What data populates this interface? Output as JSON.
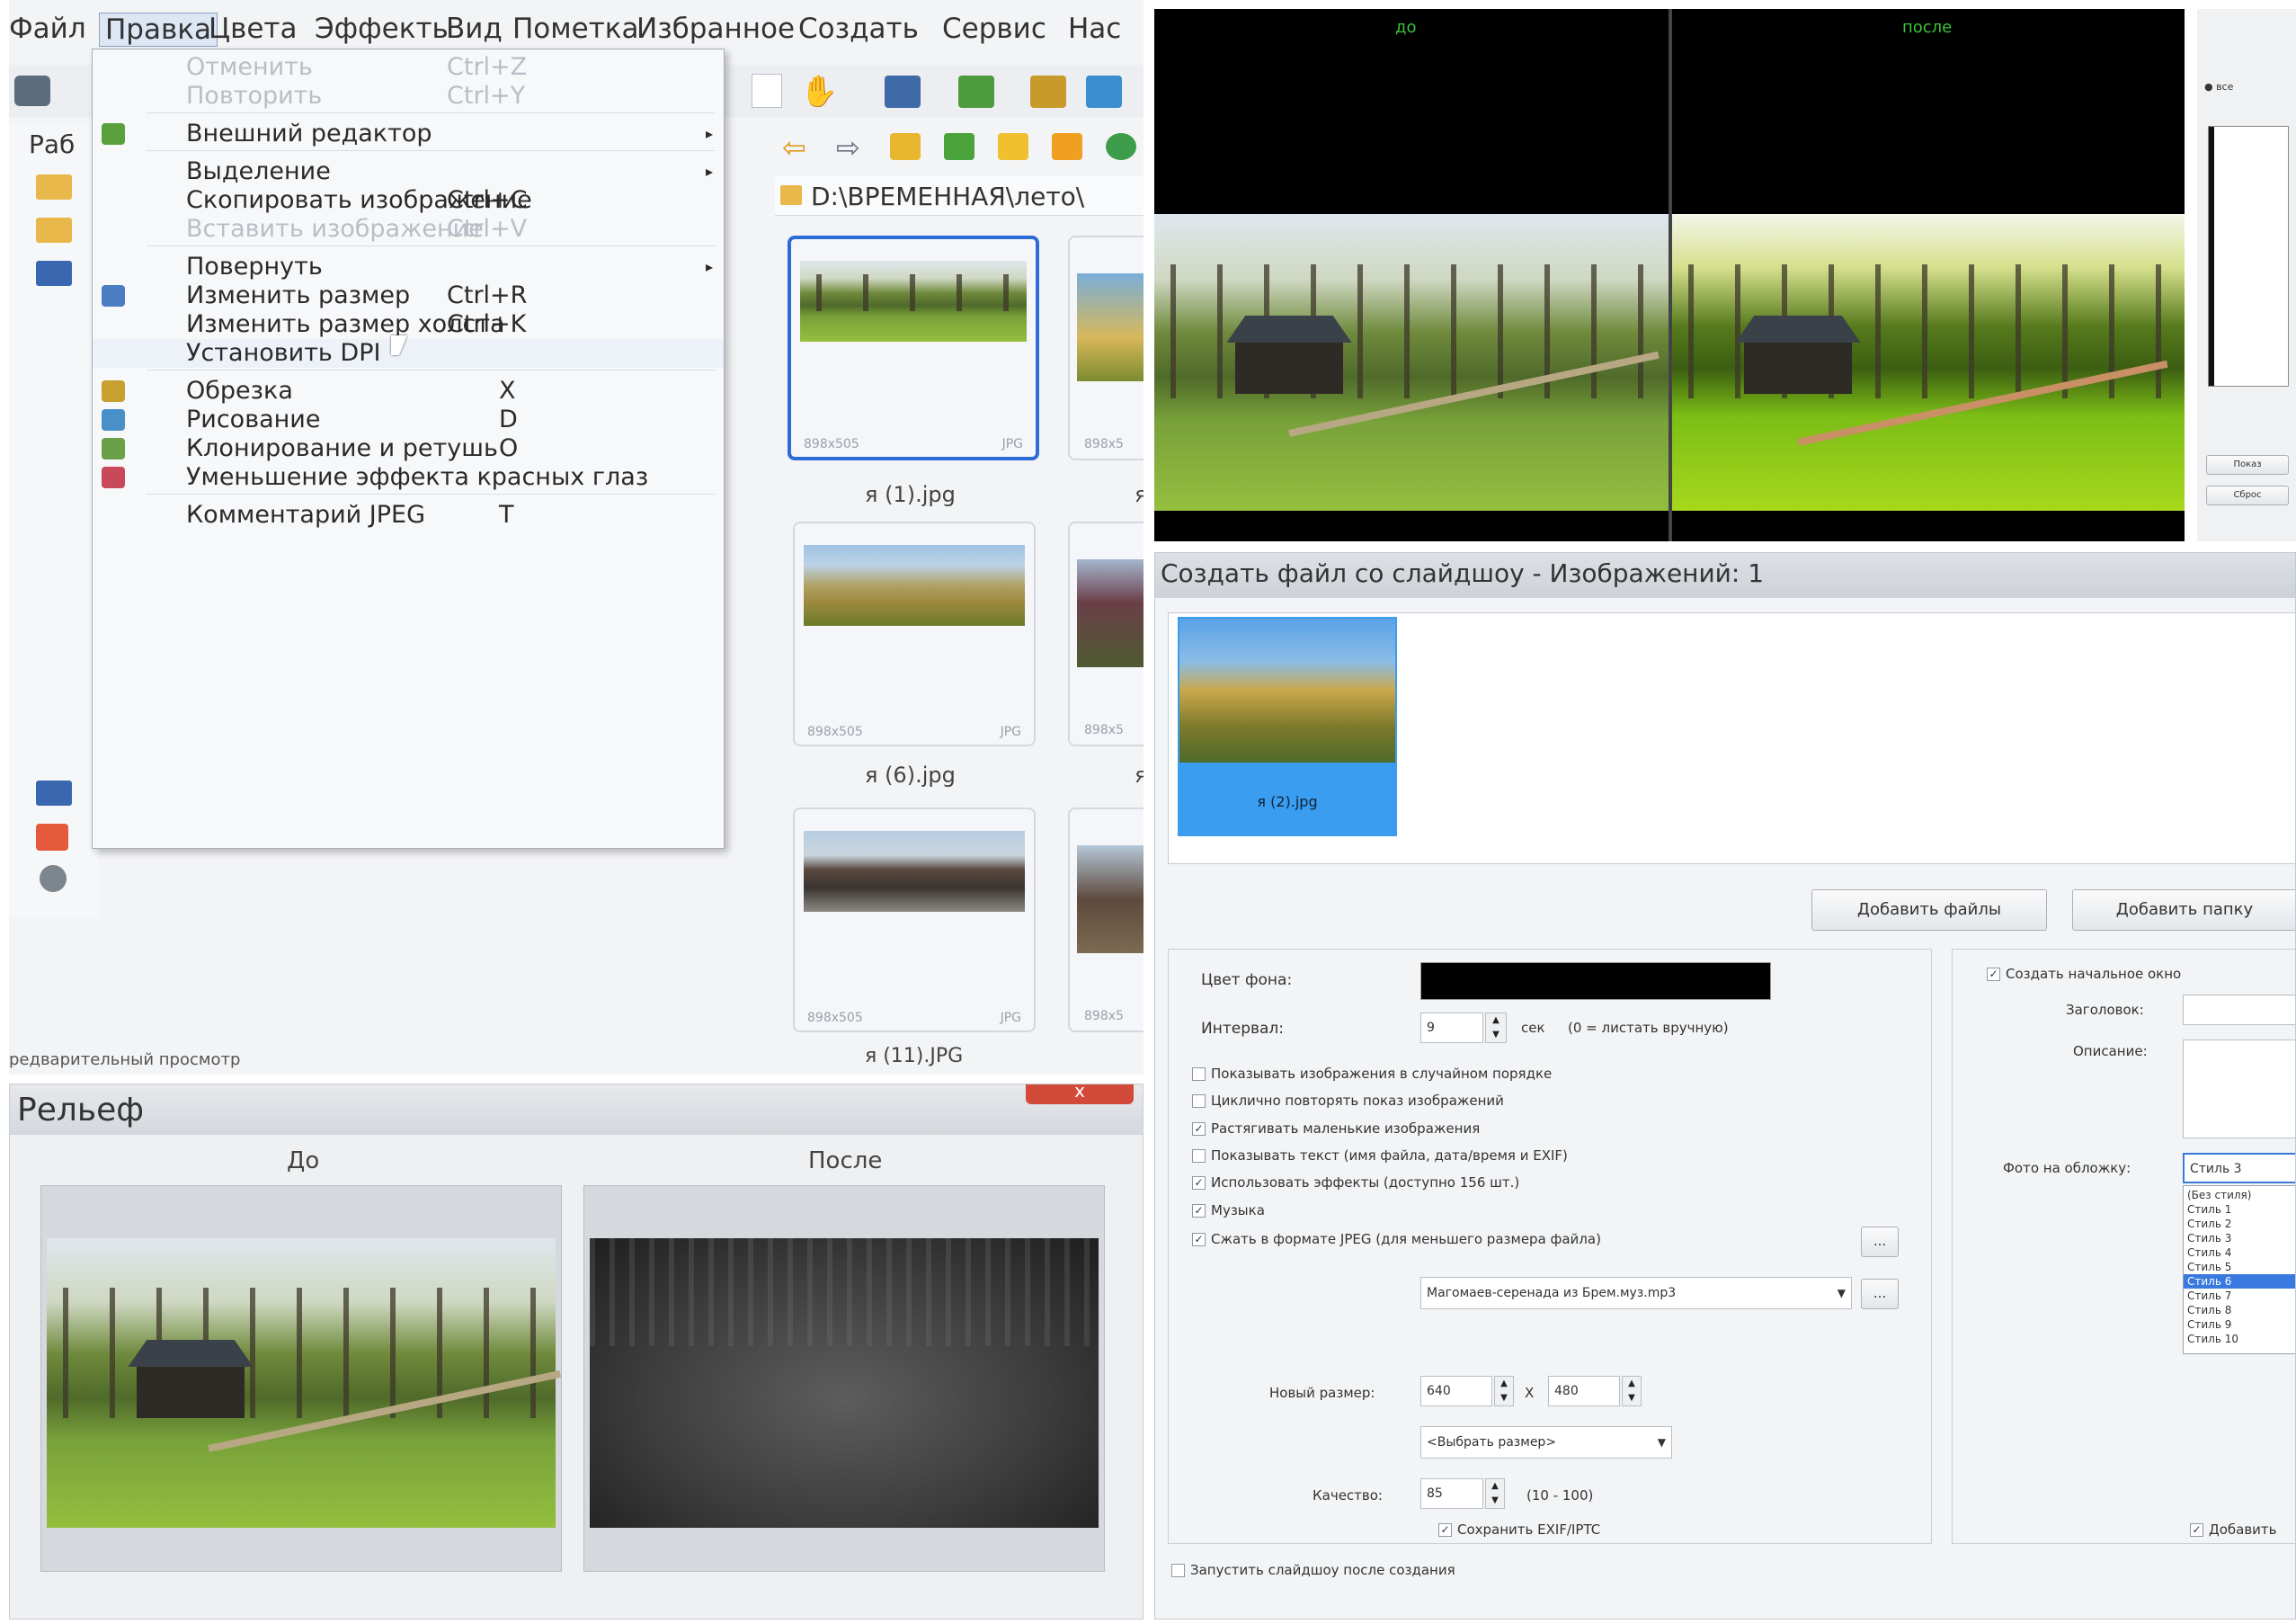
{
  "editor": {
    "menubar": [
      "Файл",
      "Правка",
      "Цвета",
      "Эффекты",
      "Вид",
      "Пометка",
      "Избранное",
      "Создать",
      "Сервис",
      "Нас"
    ],
    "tree_label": "Раб",
    "status_left": "редварительный просмотр",
    "path": "D:\\ВРЕМЕННАЯ\\лето\\",
    "menu": [
      {
        "label": "Отменить",
        "shortcut": "Ctrl+Z",
        "disabled": true
      },
      {
        "label": "Повторить",
        "shortcut": "Ctrl+Y",
        "disabled": true
      },
      {
        "label": "Внешний редактор",
        "shortcut": "",
        "submenu": true
      },
      {
        "label": "Выделение",
        "shortcut": "",
        "submenu": true
      },
      {
        "label": "Скопировать изображение",
        "shortcut": "Ctrl+C"
      },
      {
        "label": "Вставить изображение",
        "shortcut": "Ctrl+V",
        "disabled": true
      },
      {
        "label": "Повернуть",
        "shortcut": "",
        "submenu": true
      },
      {
        "label": "Изменить размер",
        "shortcut": "Ctrl+R"
      },
      {
        "label": "Изменить размер холста",
        "shortcut": "Ctrl+K"
      },
      {
        "label": "Установить DPI",
        "shortcut": ""
      },
      {
        "label": "Обрезка",
        "shortcut": "X"
      },
      {
        "label": "Рисование",
        "shortcut": "D"
      },
      {
        "label": "Клонирование и ретушь",
        "shortcut": "O"
      },
      {
        "label": "Уменьшение эффекта красных глаз",
        "shortcut": ""
      },
      {
        "label": "Комментарий JPEG",
        "shortcut": "T"
      }
    ],
    "thumbs": [
      {
        "name": "я (1).jpg",
        "size": "898x505",
        "ext": "JPG"
      },
      {
        "name": "я (6).jpg",
        "size": "898x505",
        "ext": "JPG"
      },
      {
        "name": "я (11).JPG",
        "size": "898x505",
        "ext": "JPG"
      }
    ],
    "thumb_col2_meta": "898x5",
    "thumb_col2_letter": "я"
  },
  "compare": {
    "before": "до",
    "after": "после",
    "side": {
      "radio": "все",
      "btn1": "Показ",
      "btn2": "Сброс"
    }
  },
  "relief": {
    "title": "Рельеф",
    "before": "До",
    "after": "После",
    "close": "x"
  },
  "slideshow": {
    "title": "Создать файл со слайдшоу - Изображений: 1",
    "thumb_name": "я (2).jpg",
    "add_files": "Добавить файлы",
    "add_folder": "Добавить папку",
    "bg_label": "Цвет фона:",
    "bg_color": "#000000",
    "interval_label": "Интервал:",
    "interval_value": "9",
    "interval_unit": "сек",
    "interval_note": "(0 = листать вручную)",
    "options": [
      {
        "label": "Показывать изображения в случайном порядке",
        "checked": false
      },
      {
        "label": "Циклично повторять показ изображений",
        "checked": false
      },
      {
        "label": "Растягивать маленькие изображения",
        "checked": true
      },
      {
        "label": "Показывать текст (имя файла, дата/время и EXIF)",
        "checked": false
      },
      {
        "label": "Использовать эффекты (доступно 156 шт.)",
        "checked": true
      },
      {
        "label": "Музыка",
        "checked": true
      },
      {
        "label": "Сжать в формате JPEG (для меньшего размера файла)",
        "checked": true
      }
    ],
    "music_value": "Магомаев-серенада из Брем.муз.mp3",
    "newsize_label": "Новый размер:",
    "width": "640",
    "x": "X",
    "height": "480",
    "size_select": "<Выбрать размер>",
    "quality_label": "Качество:",
    "quality_value": "85",
    "quality_range": "(10 - 100)",
    "keep_exif": "Сохранить EXIF/IPTC",
    "run_after": "Запустить слайдшоу после создания",
    "ellipsis": "...",
    "right": {
      "create_start": "Создать начальное окно",
      "header_label": "Заголовок:",
      "desc_label": "Описание:",
      "cover_label": "Фото на обложку:",
      "style_selected": "Стиль 3",
      "styles": [
        "(Без стиля)",
        "Стиль 1",
        "Стиль 2",
        "Стиль 3",
        "Стиль 4",
        "Стиль 5",
        "Стиль 6",
        "Стиль 7",
        "Стиль 8",
        "Стиль 9",
        "Стиль 10"
      ],
      "add_label": "Добавить"
    }
  }
}
